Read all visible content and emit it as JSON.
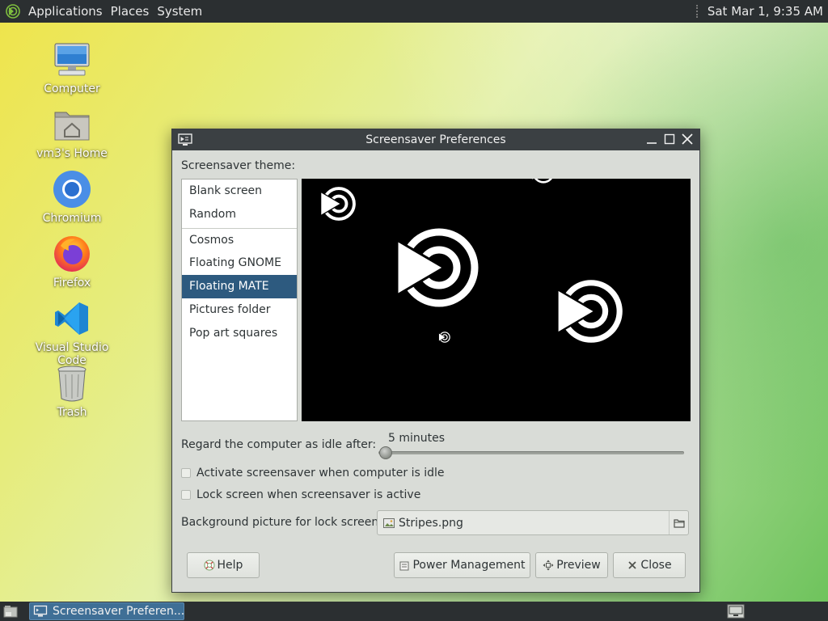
{
  "top_panel": {
    "menus": [
      "Applications",
      "Places",
      "System"
    ],
    "clock": "Sat Mar  1,  9:35 AM"
  },
  "desktop": {
    "icons": [
      {
        "label": "Computer",
        "icon": "computer-icon"
      },
      {
        "label": "vm3's Home",
        "icon": "home-folder-icon"
      },
      {
        "label": "Chromium",
        "icon": "chromium-icon"
      },
      {
        "label": "Firefox",
        "icon": "firefox-icon"
      },
      {
        "label": "Visual Studio Code",
        "icon": "vscode-icon"
      },
      {
        "label": "Trash",
        "icon": "trash-icon"
      }
    ]
  },
  "window": {
    "title": "Screensaver Preferences",
    "theme_label": "Screensaver theme:",
    "themes": [
      "Blank screen",
      "Random",
      "Cosmos",
      "Floating GNOME",
      "Floating MATE",
      "Pictures folder",
      "Pop art squares"
    ],
    "selected_theme": "Floating MATE",
    "idle_label": "Regard the computer as idle after:",
    "idle_value": "5 minutes",
    "idle_fraction": 0.0,
    "activate_label": "Activate screensaver when computer is idle",
    "activate_checked": false,
    "lock_label": "Lock screen when screensaver is active",
    "lock_checked": false,
    "bg_label": "Background picture for lock screen:",
    "bg_file": "Stripes.png",
    "buttons": {
      "help": "Help",
      "power": "Power Management",
      "preview": "Preview",
      "close": "Close"
    }
  },
  "taskbar": {
    "task_label": "Screensaver Preferen..."
  },
  "colors": {
    "panel": "#2b2f31",
    "selection": "#2d5a7f",
    "window_bg": "#d9dcd7"
  }
}
